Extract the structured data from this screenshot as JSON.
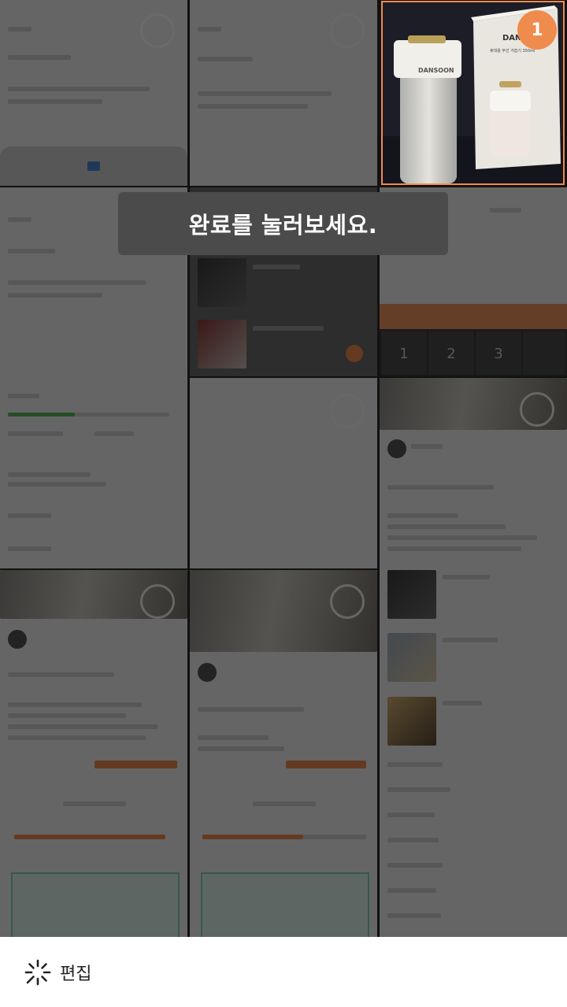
{
  "toast": {
    "message": "완료를 눌러보세요."
  },
  "selection": {
    "count_badge": "1"
  },
  "bottom_bar": {
    "edit_label": "편집",
    "edit_icon": "sparkle-icon"
  },
  "product": {
    "brand": "DANSOON",
    "box_text": "DANSOON",
    "box_subtitle": "휴대용 무선 가습기 350ml"
  },
  "keypad": {
    "keys": [
      "1",
      "2",
      "3"
    ]
  },
  "colors": {
    "accent": "#ef8b4d",
    "dim_overlay": "rgba(0,0,0,0.58)",
    "toast_bg": "#4b4b4b"
  }
}
